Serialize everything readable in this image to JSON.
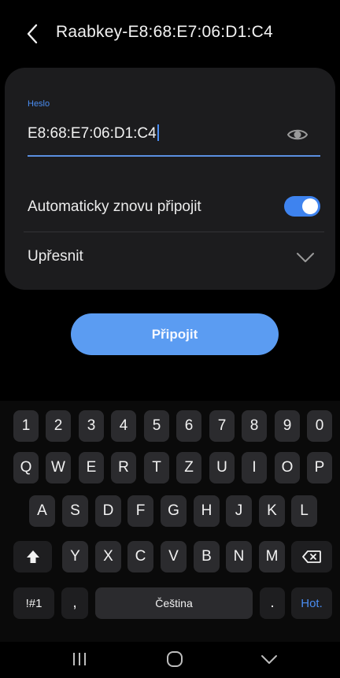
{
  "header": {
    "title": "Raabkey-E8:68:E7:06:D1:C4"
  },
  "password": {
    "label": "Heslo",
    "value": "E8:68:E7:06:D1:C4"
  },
  "auto_reconnect": {
    "label": "Automaticky znovu připojit",
    "enabled": true
  },
  "advanced": {
    "label": "Upřesnit"
  },
  "connect_button": {
    "label": "Připojit"
  },
  "keyboard": {
    "number_row": [
      "1",
      "2",
      "3",
      "4",
      "5",
      "6",
      "7",
      "8",
      "9",
      "0"
    ],
    "row1": [
      "Q",
      "W",
      "E",
      "R",
      "T",
      "Z",
      "U",
      "I",
      "O",
      "P"
    ],
    "row2": [
      "A",
      "S",
      "D",
      "F",
      "G",
      "H",
      "J",
      "K",
      "L"
    ],
    "row3": [
      "Y",
      "X",
      "C",
      "V",
      "B",
      "N",
      "M"
    ],
    "symbols_key": "!#1",
    "comma_key": ",",
    "space_key": "Čeština",
    "period_key": ".",
    "action_key": "Hot."
  },
  "colors": {
    "accent": "#4a8df2",
    "button": "#5b9cf2",
    "card": "#1c1c1e"
  }
}
